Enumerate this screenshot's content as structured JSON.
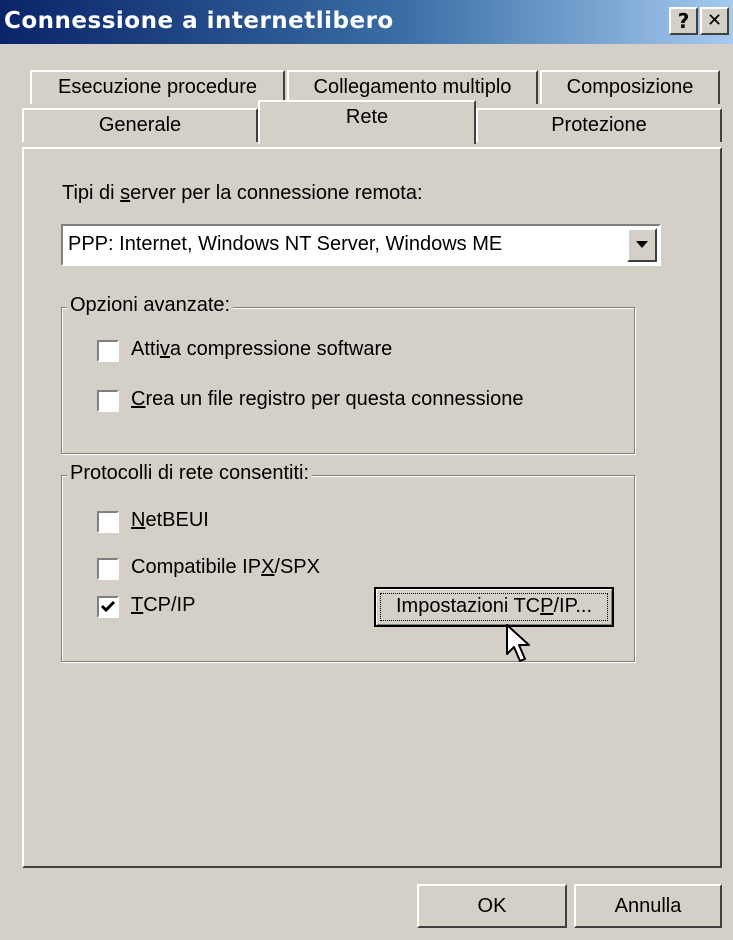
{
  "window": {
    "title": "Connessione a internetlibero",
    "help_btn": "?",
    "close_btn": "✕"
  },
  "tabs": {
    "row1": [
      "Esecuzione procedure",
      "Collegamento multiplo",
      "Composizione"
    ],
    "row2": [
      "Generale",
      "Rete",
      "Protezione"
    ],
    "selected": "Rete"
  },
  "server": {
    "label_pre": "Tipi di ",
    "label_key": "s",
    "label_post": "erver per la connessione remota:",
    "value": "PPP: Internet, Windows NT Server, Windows ME"
  },
  "advanced": {
    "legend": "Opzioni avanzate:",
    "compression": {
      "pre": "Atti",
      "key": "v",
      "post": "a compressione software",
      "checked": false
    },
    "log": {
      "pre": "",
      "key": "C",
      "post": "rea un file registro per questa connessione",
      "checked": false
    }
  },
  "protocols": {
    "legend": "Protocolli di rete consentiti:",
    "netbeui": {
      "pre": "",
      "key": "N",
      "post": "etBEUI",
      "checked": false
    },
    "ipx": {
      "pre": "Compatibile IP",
      "key": "X",
      "post": "/SPX",
      "checked": false
    },
    "tcpip": {
      "pre": "",
      "key": "T",
      "post": "CP/IP",
      "checked": true
    },
    "settings_btn": {
      "pre": "Impostazioni TC",
      "key": "P",
      "post": "/IP..."
    }
  },
  "footer": {
    "ok": "OK",
    "cancel": "Annulla"
  }
}
